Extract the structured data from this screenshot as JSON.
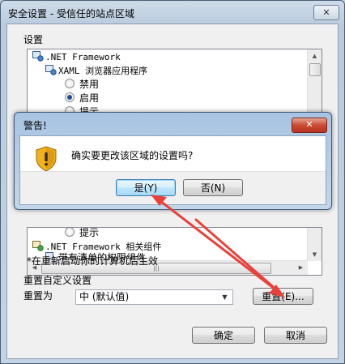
{
  "window": {
    "title": "安全设置 - 受信任的站点区域",
    "close_glyph": "✕"
  },
  "settings": {
    "label": "设置",
    "tree_top": [
      {
        "kind": "group",
        "text": ".NET Framework",
        "icon": "settings-gear-icon"
      },
      {
        "kind": "subgroup",
        "text": "XAML 浏览器应用程序",
        "icon": "settings-gear-icon"
      },
      {
        "kind": "option",
        "text": "禁用",
        "selected": false
      },
      {
        "kind": "option",
        "text": "启用",
        "selected": true
      },
      {
        "kind": "option",
        "text": "提示",
        "selected": false
      }
    ],
    "tree_bottom": [
      {
        "kind": "option",
        "text": "提示",
        "selected": false
      },
      {
        "kind": "group",
        "text": ".NET Framework 相关组件",
        "icon": "settings-gear-icon"
      },
      {
        "kind": "subgroup",
        "text": "带有清单的权限组件",
        "icon": "settings-gear-icon"
      }
    ],
    "note": "*在重新启动你的计算机后生效"
  },
  "reset": {
    "group_label": "重置自定义设置",
    "reset_to_label": "重置为",
    "combo_value": "中 (默认值)",
    "reset_button": "重置(E)..."
  },
  "footer": {
    "ok": "确定",
    "cancel": "取消"
  },
  "dialog": {
    "title": "警告!",
    "close_glyph": "✕",
    "message": "确实要更改该区域的设置吗?",
    "yes": "是(Y)",
    "no": "否(N)",
    "icon": "warning-shield-icon"
  },
  "colors": {
    "accent": "#1d4f91",
    "annotation_arrow": "#e8413a",
    "dialog_close": "#c94a33"
  }
}
